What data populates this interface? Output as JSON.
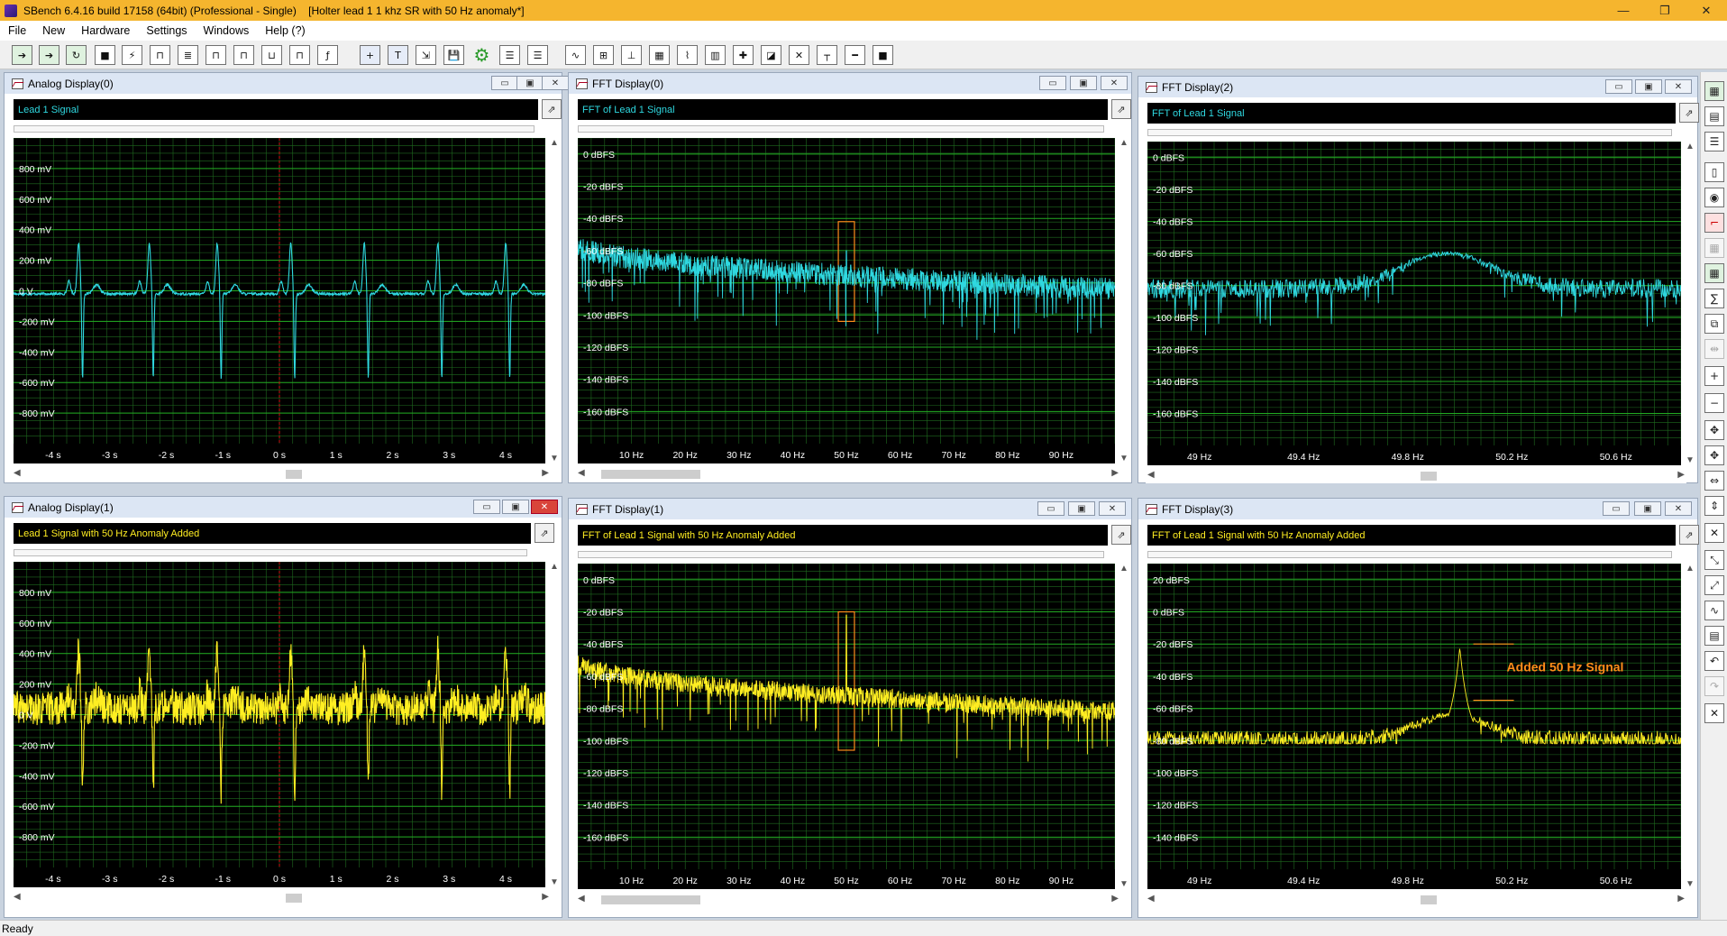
{
  "app": {
    "title": "SBench 6.4.16 build 17158 (64bit) (Professional - Single)    [Holter lead 1 1 khz SR with 50 Hz anomaly*]",
    "status": "Ready",
    "window_controls": {
      "minimize": "—",
      "restore": "❐",
      "close": "✕"
    }
  },
  "menu": [
    "File",
    "New",
    "Hardware",
    "Settings",
    "Windows",
    "Help (?)"
  ],
  "colors": {
    "cyan": "#2fd8e0",
    "yellow": "#ffee22",
    "grid": "#1f6b1f",
    "major_grid": "#22aa22",
    "accent": "#f5b52e",
    "annotation": "#ff8c1a"
  },
  "panels": [
    {
      "title": "Analog Display(0)",
      "signal_label": "Lead 1 Signal",
      "kind": "analog",
      "color": "#2fd8e0",
      "y_ticks": [
        "800 mV",
        "600 mV",
        "400 mV",
        "200 mV",
        "0 V",
        "-200 mV",
        "-400 mV",
        "-600 mV",
        "-800 mV"
      ],
      "x_ticks": [
        "-4 s",
        "-3 s",
        "-2 s",
        "-1 s",
        "0 s",
        "1 s",
        "2 s",
        "3 s",
        "4 s"
      ],
      "chart_data": {
        "type": "line",
        "title": "",
        "xlabel": "",
        "ylabel": "",
        "x_unit": "s",
        "y_unit": "mV",
        "xlim": [
          -4.7,
          4.7
        ],
        "ylim": [
          -1000,
          1000
        ],
        "beats_at_s": [
          -3.55,
          -2.3,
          -1.1,
          0.2,
          1.5,
          2.8,
          4.0
        ],
        "r_peak_mV": 330,
        "s_trough_mV": -560,
        "baseline_mV": -20,
        "noise_mV": 8
      }
    },
    {
      "title": "FFT Display(0)",
      "signal_label": "FFT of Lead 1 Signal",
      "kind": "fft",
      "color": "#2fd8e0",
      "y_ticks": [
        "0 dBFS",
        "-20 dBFS",
        "-40 dBFS",
        "-60 dBFS",
        "-80 dBFS",
        "-100 dBFS",
        "-120 dBFS",
        "-140 dBFS",
        "-160 dBFS"
      ],
      "x_ticks": [
        "10 Hz",
        "20 Hz",
        "30 Hz",
        "40 Hz",
        "50 Hz",
        "60 Hz",
        "70 Hz",
        "80 Hz",
        "90 Hz"
      ],
      "chart_data": {
        "type": "line",
        "title": "",
        "xlabel": "",
        "ylabel": "",
        "x_unit": "Hz",
        "y_unit": "dBFS",
        "xlim": [
          0,
          100
        ],
        "ylim": [
          -180,
          10
        ],
        "floor_start_dB": -55,
        "floor_end_dB": -82,
        "spread_dB": 14,
        "peak": null,
        "highlight_box": {
          "x_from_Hz": 48.5,
          "x_to_Hz": 51.5,
          "y_top_dB": -42,
          "y_bottom_dB": -104
        }
      }
    },
    {
      "title": "FFT Display(2)",
      "signal_label": "FFT of Lead 1 Signal",
      "kind": "fft_zoom",
      "color": "#2fd8e0",
      "y_ticks": [
        "0 dBFS",
        "-20 dBFS",
        "-40 dBFS",
        "-60 dBFS",
        "-80 dBFS",
        "-100 dBFS",
        "-120 dBFS",
        "-140 dBFS",
        "-160 dBFS"
      ],
      "x_ticks": [
        "49 Hz",
        "49.4 Hz",
        "49.8 Hz",
        "50.2 Hz",
        "50.6 Hz"
      ],
      "chart_data": {
        "type": "line",
        "title": "",
        "xlabel": "",
        "ylabel": "",
        "x_unit": "Hz",
        "y_unit": "dBFS",
        "xlim": [
          48.8,
          50.85
        ],
        "ylim": [
          -180,
          10
        ],
        "floor_dB": -82,
        "spread_dB": 6,
        "bump": {
          "center_Hz": 49.95,
          "level_dB": -60,
          "width_Hz": 0.25
        }
      }
    },
    {
      "title": "Analog Display(1)",
      "signal_label": "Lead 1 Signal with 50 Hz Anomaly Added",
      "kind": "analog",
      "color": "#ffee22",
      "y_ticks": [
        "800 mV",
        "600 mV",
        "400 mV",
        "200 mV",
        "0 V",
        "-200 mV",
        "-400 mV",
        "-600 mV",
        "-800 mV"
      ],
      "x_ticks": [
        "-4 s",
        "-3 s",
        "-2 s",
        "-1 s",
        "0 s",
        "1 s",
        "2 s",
        "3 s",
        "4 s"
      ],
      "chart_data": {
        "type": "line",
        "title": "",
        "xlabel": "",
        "ylabel": "",
        "x_unit": "s",
        "y_unit": "mV",
        "xlim": [
          -4.7,
          4.7
        ],
        "ylim": [
          -1000,
          1000
        ],
        "beats_at_s": [
          -3.55,
          -2.3,
          -1.1,
          0.2,
          1.5,
          2.8,
          4.0
        ],
        "r_peak_mV": 380,
        "s_trough_mV": -560,
        "baseline_mV": 40,
        "noise_mV": 110
      }
    },
    {
      "title": "FFT Display(1)",
      "signal_label": "FFT of Lead 1 Signal with 50 Hz Anomaly Added",
      "kind": "fft",
      "color": "#ffee22",
      "y_ticks": [
        "0 dBFS",
        "-20 dBFS",
        "-40 dBFS",
        "-60 dBFS",
        "-80 dBFS",
        "-100 dBFS",
        "-120 dBFS",
        "-140 dBFS",
        "-160 dBFS"
      ],
      "x_ticks": [
        "10 Hz",
        "20 Hz",
        "30 Hz",
        "40 Hz",
        "50 Hz",
        "60 Hz",
        "70 Hz",
        "80 Hz",
        "90 Hz"
      ],
      "chart_data": {
        "type": "line",
        "title": "",
        "xlabel": "",
        "ylabel": "",
        "x_unit": "Hz",
        "y_unit": "dBFS",
        "xlim": [
          0,
          100
        ],
        "ylim": [
          -180,
          10
        ],
        "floor_start_dB": -50,
        "floor_end_dB": -80,
        "spread_dB": 12,
        "peak": {
          "x_Hz": 50,
          "level_dB": -22
        },
        "highlight_box": {
          "x_from_Hz": 48.5,
          "x_to_Hz": 51.5,
          "y_top_dB": -20,
          "y_bottom_dB": -106
        }
      }
    },
    {
      "title": "FFT Display(3)",
      "signal_label": "FFT of Lead 1 Signal with 50 Hz Anomaly Added",
      "kind": "fft_zoom",
      "color": "#ffee22",
      "y_ticks": [
        "20 dBFS",
        "0 dBFS",
        "-20 dBFS",
        "-40 dBFS",
        "-60 dBFS",
        "-80 dBFS",
        "-100 dBFS",
        "-120 dBFS",
        "-140 dBFS"
      ],
      "x_ticks": [
        "49 Hz",
        "49.4 Hz",
        "49.8 Hz",
        "50.2 Hz",
        "50.6 Hz"
      ],
      "annotation": "Added 50 Hz Signal",
      "chart_data": {
        "type": "line",
        "title": "",
        "xlabel": "",
        "ylabel": "",
        "x_unit": "Hz",
        "y_unit": "dBFS",
        "xlim": [
          48.8,
          50.85
        ],
        "ylim": [
          -160,
          30
        ],
        "floor_dB": -80,
        "spread_dB": 6,
        "peak": {
          "x_Hz": 50.0,
          "level_dB": -22
        },
        "bump": {
          "center_Hz": 49.97,
          "level_dB": -64,
          "width_Hz": 0.2
        }
      }
    }
  ]
}
